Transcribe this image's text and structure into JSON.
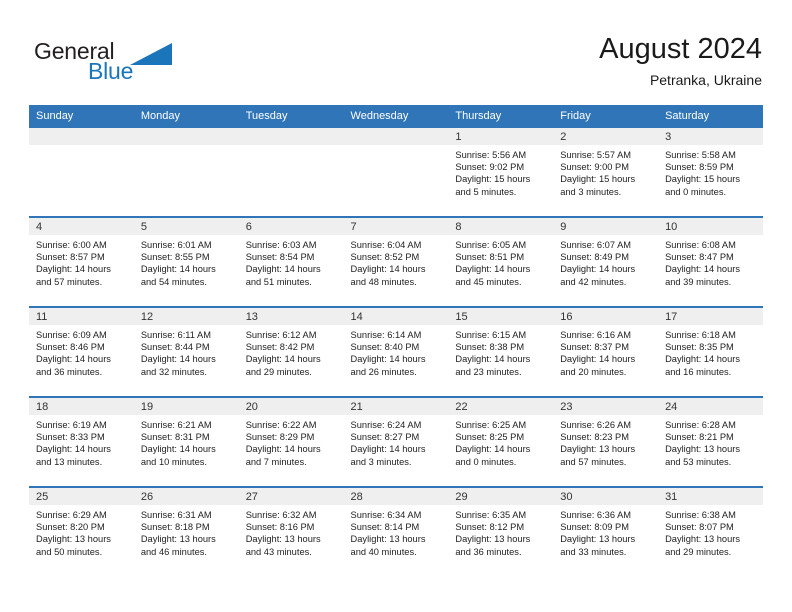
{
  "brand": {
    "name_part1": "General",
    "name_part2": "Blue",
    "accent_color": "#1b75bb"
  },
  "header": {
    "title": "August 2024",
    "subtitle": "Petranka, Ukraine"
  },
  "theme": {
    "header_blue": "#3075b8",
    "daynum_band": "#efefef",
    "cell_background": "#ffffff"
  },
  "calendar": {
    "weekday_headers": [
      "Sunday",
      "Monday",
      "Tuesday",
      "Wednesday",
      "Thursday",
      "Friday",
      "Saturday"
    ],
    "weeks": [
      [
        {
          "day": "",
          "lines": []
        },
        {
          "day": "",
          "lines": []
        },
        {
          "day": "",
          "lines": []
        },
        {
          "day": "",
          "lines": []
        },
        {
          "day": "1",
          "lines": [
            "Sunrise: 5:56 AM",
            "Sunset: 9:02 PM",
            "Daylight: 15 hours",
            "and 5 minutes."
          ]
        },
        {
          "day": "2",
          "lines": [
            "Sunrise: 5:57 AM",
            "Sunset: 9:00 PM",
            "Daylight: 15 hours",
            "and 3 minutes."
          ]
        },
        {
          "day": "3",
          "lines": [
            "Sunrise: 5:58 AM",
            "Sunset: 8:59 PM",
            "Daylight: 15 hours",
            "and 0 minutes."
          ]
        }
      ],
      [
        {
          "day": "4",
          "lines": [
            "Sunrise: 6:00 AM",
            "Sunset: 8:57 PM",
            "Daylight: 14 hours",
            "and 57 minutes."
          ]
        },
        {
          "day": "5",
          "lines": [
            "Sunrise: 6:01 AM",
            "Sunset: 8:55 PM",
            "Daylight: 14 hours",
            "and 54 minutes."
          ]
        },
        {
          "day": "6",
          "lines": [
            "Sunrise: 6:03 AM",
            "Sunset: 8:54 PM",
            "Daylight: 14 hours",
            "and 51 minutes."
          ]
        },
        {
          "day": "7",
          "lines": [
            "Sunrise: 6:04 AM",
            "Sunset: 8:52 PM",
            "Daylight: 14 hours",
            "and 48 minutes."
          ]
        },
        {
          "day": "8",
          "lines": [
            "Sunrise: 6:05 AM",
            "Sunset: 8:51 PM",
            "Daylight: 14 hours",
            "and 45 minutes."
          ]
        },
        {
          "day": "9",
          "lines": [
            "Sunrise: 6:07 AM",
            "Sunset: 8:49 PM",
            "Daylight: 14 hours",
            "and 42 minutes."
          ]
        },
        {
          "day": "10",
          "lines": [
            "Sunrise: 6:08 AM",
            "Sunset: 8:47 PM",
            "Daylight: 14 hours",
            "and 39 minutes."
          ]
        }
      ],
      [
        {
          "day": "11",
          "lines": [
            "Sunrise: 6:09 AM",
            "Sunset: 8:46 PM",
            "Daylight: 14 hours",
            "and 36 minutes."
          ]
        },
        {
          "day": "12",
          "lines": [
            "Sunrise: 6:11 AM",
            "Sunset: 8:44 PM",
            "Daylight: 14 hours",
            "and 32 minutes."
          ]
        },
        {
          "day": "13",
          "lines": [
            "Sunrise: 6:12 AM",
            "Sunset: 8:42 PM",
            "Daylight: 14 hours",
            "and 29 minutes."
          ]
        },
        {
          "day": "14",
          "lines": [
            "Sunrise: 6:14 AM",
            "Sunset: 8:40 PM",
            "Daylight: 14 hours",
            "and 26 minutes."
          ]
        },
        {
          "day": "15",
          "lines": [
            "Sunrise: 6:15 AM",
            "Sunset: 8:38 PM",
            "Daylight: 14 hours",
            "and 23 minutes."
          ]
        },
        {
          "day": "16",
          "lines": [
            "Sunrise: 6:16 AM",
            "Sunset: 8:37 PM",
            "Daylight: 14 hours",
            "and 20 minutes."
          ]
        },
        {
          "day": "17",
          "lines": [
            "Sunrise: 6:18 AM",
            "Sunset: 8:35 PM",
            "Daylight: 14 hours",
            "and 16 minutes."
          ]
        }
      ],
      [
        {
          "day": "18",
          "lines": [
            "Sunrise: 6:19 AM",
            "Sunset: 8:33 PM",
            "Daylight: 14 hours",
            "and 13 minutes."
          ]
        },
        {
          "day": "19",
          "lines": [
            "Sunrise: 6:21 AM",
            "Sunset: 8:31 PM",
            "Daylight: 14 hours",
            "and 10 minutes."
          ]
        },
        {
          "day": "20",
          "lines": [
            "Sunrise: 6:22 AM",
            "Sunset: 8:29 PM",
            "Daylight: 14 hours",
            "and 7 minutes."
          ]
        },
        {
          "day": "21",
          "lines": [
            "Sunrise: 6:24 AM",
            "Sunset: 8:27 PM",
            "Daylight: 14 hours",
            "and 3 minutes."
          ]
        },
        {
          "day": "22",
          "lines": [
            "Sunrise: 6:25 AM",
            "Sunset: 8:25 PM",
            "Daylight: 14 hours",
            "and 0 minutes."
          ]
        },
        {
          "day": "23",
          "lines": [
            "Sunrise: 6:26 AM",
            "Sunset: 8:23 PM",
            "Daylight: 13 hours",
            "and 57 minutes."
          ]
        },
        {
          "day": "24",
          "lines": [
            "Sunrise: 6:28 AM",
            "Sunset: 8:21 PM",
            "Daylight: 13 hours",
            "and 53 minutes."
          ]
        }
      ],
      [
        {
          "day": "25",
          "lines": [
            "Sunrise: 6:29 AM",
            "Sunset: 8:20 PM",
            "Daylight: 13 hours",
            "and 50 minutes."
          ]
        },
        {
          "day": "26",
          "lines": [
            "Sunrise: 6:31 AM",
            "Sunset: 8:18 PM",
            "Daylight: 13 hours",
            "and 46 minutes."
          ]
        },
        {
          "day": "27",
          "lines": [
            "Sunrise: 6:32 AM",
            "Sunset: 8:16 PM",
            "Daylight: 13 hours",
            "and 43 minutes."
          ]
        },
        {
          "day": "28",
          "lines": [
            "Sunrise: 6:34 AM",
            "Sunset: 8:14 PM",
            "Daylight: 13 hours",
            "and 40 minutes."
          ]
        },
        {
          "day": "29",
          "lines": [
            "Sunrise: 6:35 AM",
            "Sunset: 8:12 PM",
            "Daylight: 13 hours",
            "and 36 minutes."
          ]
        },
        {
          "day": "30",
          "lines": [
            "Sunrise: 6:36 AM",
            "Sunset: 8:09 PM",
            "Daylight: 13 hours",
            "and 33 minutes."
          ]
        },
        {
          "day": "31",
          "lines": [
            "Sunrise: 6:38 AM",
            "Sunset: 8:07 PM",
            "Daylight: 13 hours",
            "and 29 minutes."
          ]
        }
      ]
    ]
  }
}
